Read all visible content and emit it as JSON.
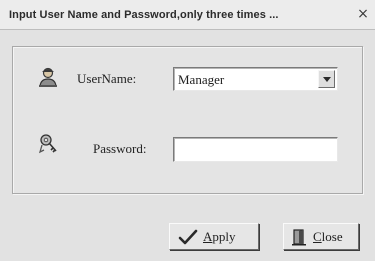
{
  "window": {
    "title": "Input User Name and Password,only three times ...",
    "close_glyph": "×"
  },
  "form": {
    "username_label": "UserName:",
    "username_value": "Manager",
    "password_label": "Password:",
    "password_value": ""
  },
  "buttons": {
    "apply": {
      "mnemonic": "A",
      "rest": "pply",
      "icon": "check-icon"
    },
    "close": {
      "mnemonic": "C",
      "rest": "lose",
      "icon": "door-icon"
    }
  },
  "icons": {
    "username": "user-icon",
    "password": "keys-icon"
  }
}
